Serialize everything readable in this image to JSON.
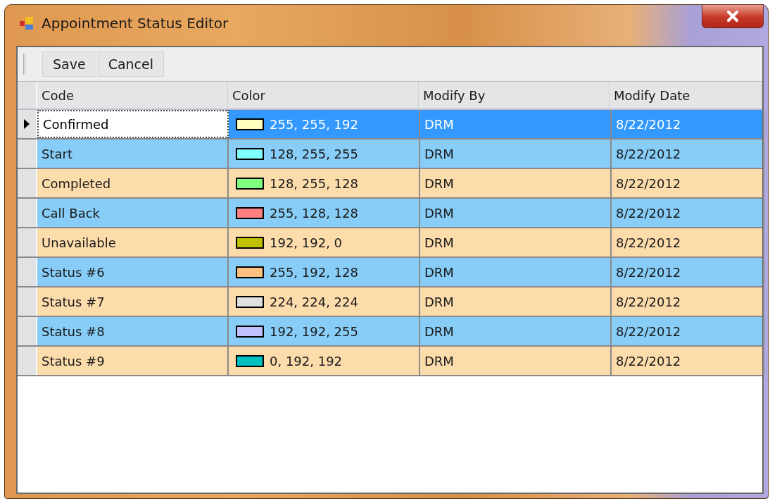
{
  "window": {
    "title": "Appointment Status Editor"
  },
  "toolbar": {
    "buttons": [
      "Save",
      "Cancel"
    ]
  },
  "table": {
    "columns": [
      "Code",
      "Color",
      "Modify By",
      "Modify Date"
    ],
    "rows": [
      {
        "code": "Confirmed",
        "color": "#ffffc0",
        "color_text": "255, 255, 192",
        "modify_by": "DRM",
        "modify_date": "8/22/2012",
        "selected": true
      },
      {
        "code": "Start",
        "color": "#80ffff",
        "color_text": "128, 255, 255",
        "modify_by": "DRM",
        "modify_date": "8/22/2012",
        "selected": false
      },
      {
        "code": "Completed",
        "color": "#80ff80",
        "color_text": "128, 255, 128",
        "modify_by": "DRM",
        "modify_date": "8/22/2012",
        "selected": false
      },
      {
        "code": "Call Back",
        "color": "#ff8080",
        "color_text": "255, 128, 128",
        "modify_by": "DRM",
        "modify_date": "8/22/2012",
        "selected": false
      },
      {
        "code": "Unavailable",
        "color": "#c0c000",
        "color_text": "192, 192, 0",
        "modify_by": "DRM",
        "modify_date": "8/22/2012",
        "selected": false
      },
      {
        "code": "Status #6",
        "color": "#ffc080",
        "color_text": "255, 192, 128",
        "modify_by": "DRM",
        "modify_date": "8/22/2012",
        "selected": false
      },
      {
        "code": "Status #7",
        "color": "#e0e0e0",
        "color_text": "224, 224, 224",
        "modify_by": "DRM",
        "modify_date": "8/22/2012",
        "selected": false
      },
      {
        "code": "Status #8",
        "color": "#c0c0ff",
        "color_text": "192, 192, 255",
        "modify_by": "DRM",
        "modify_date": "8/22/2012",
        "selected": false
      },
      {
        "code": "Status #9",
        "color": "#00c0c0",
        "color_text": "0, 192, 192",
        "modify_by": "DRM",
        "modify_date": "8/22/2012",
        "selected": false
      }
    ]
  }
}
